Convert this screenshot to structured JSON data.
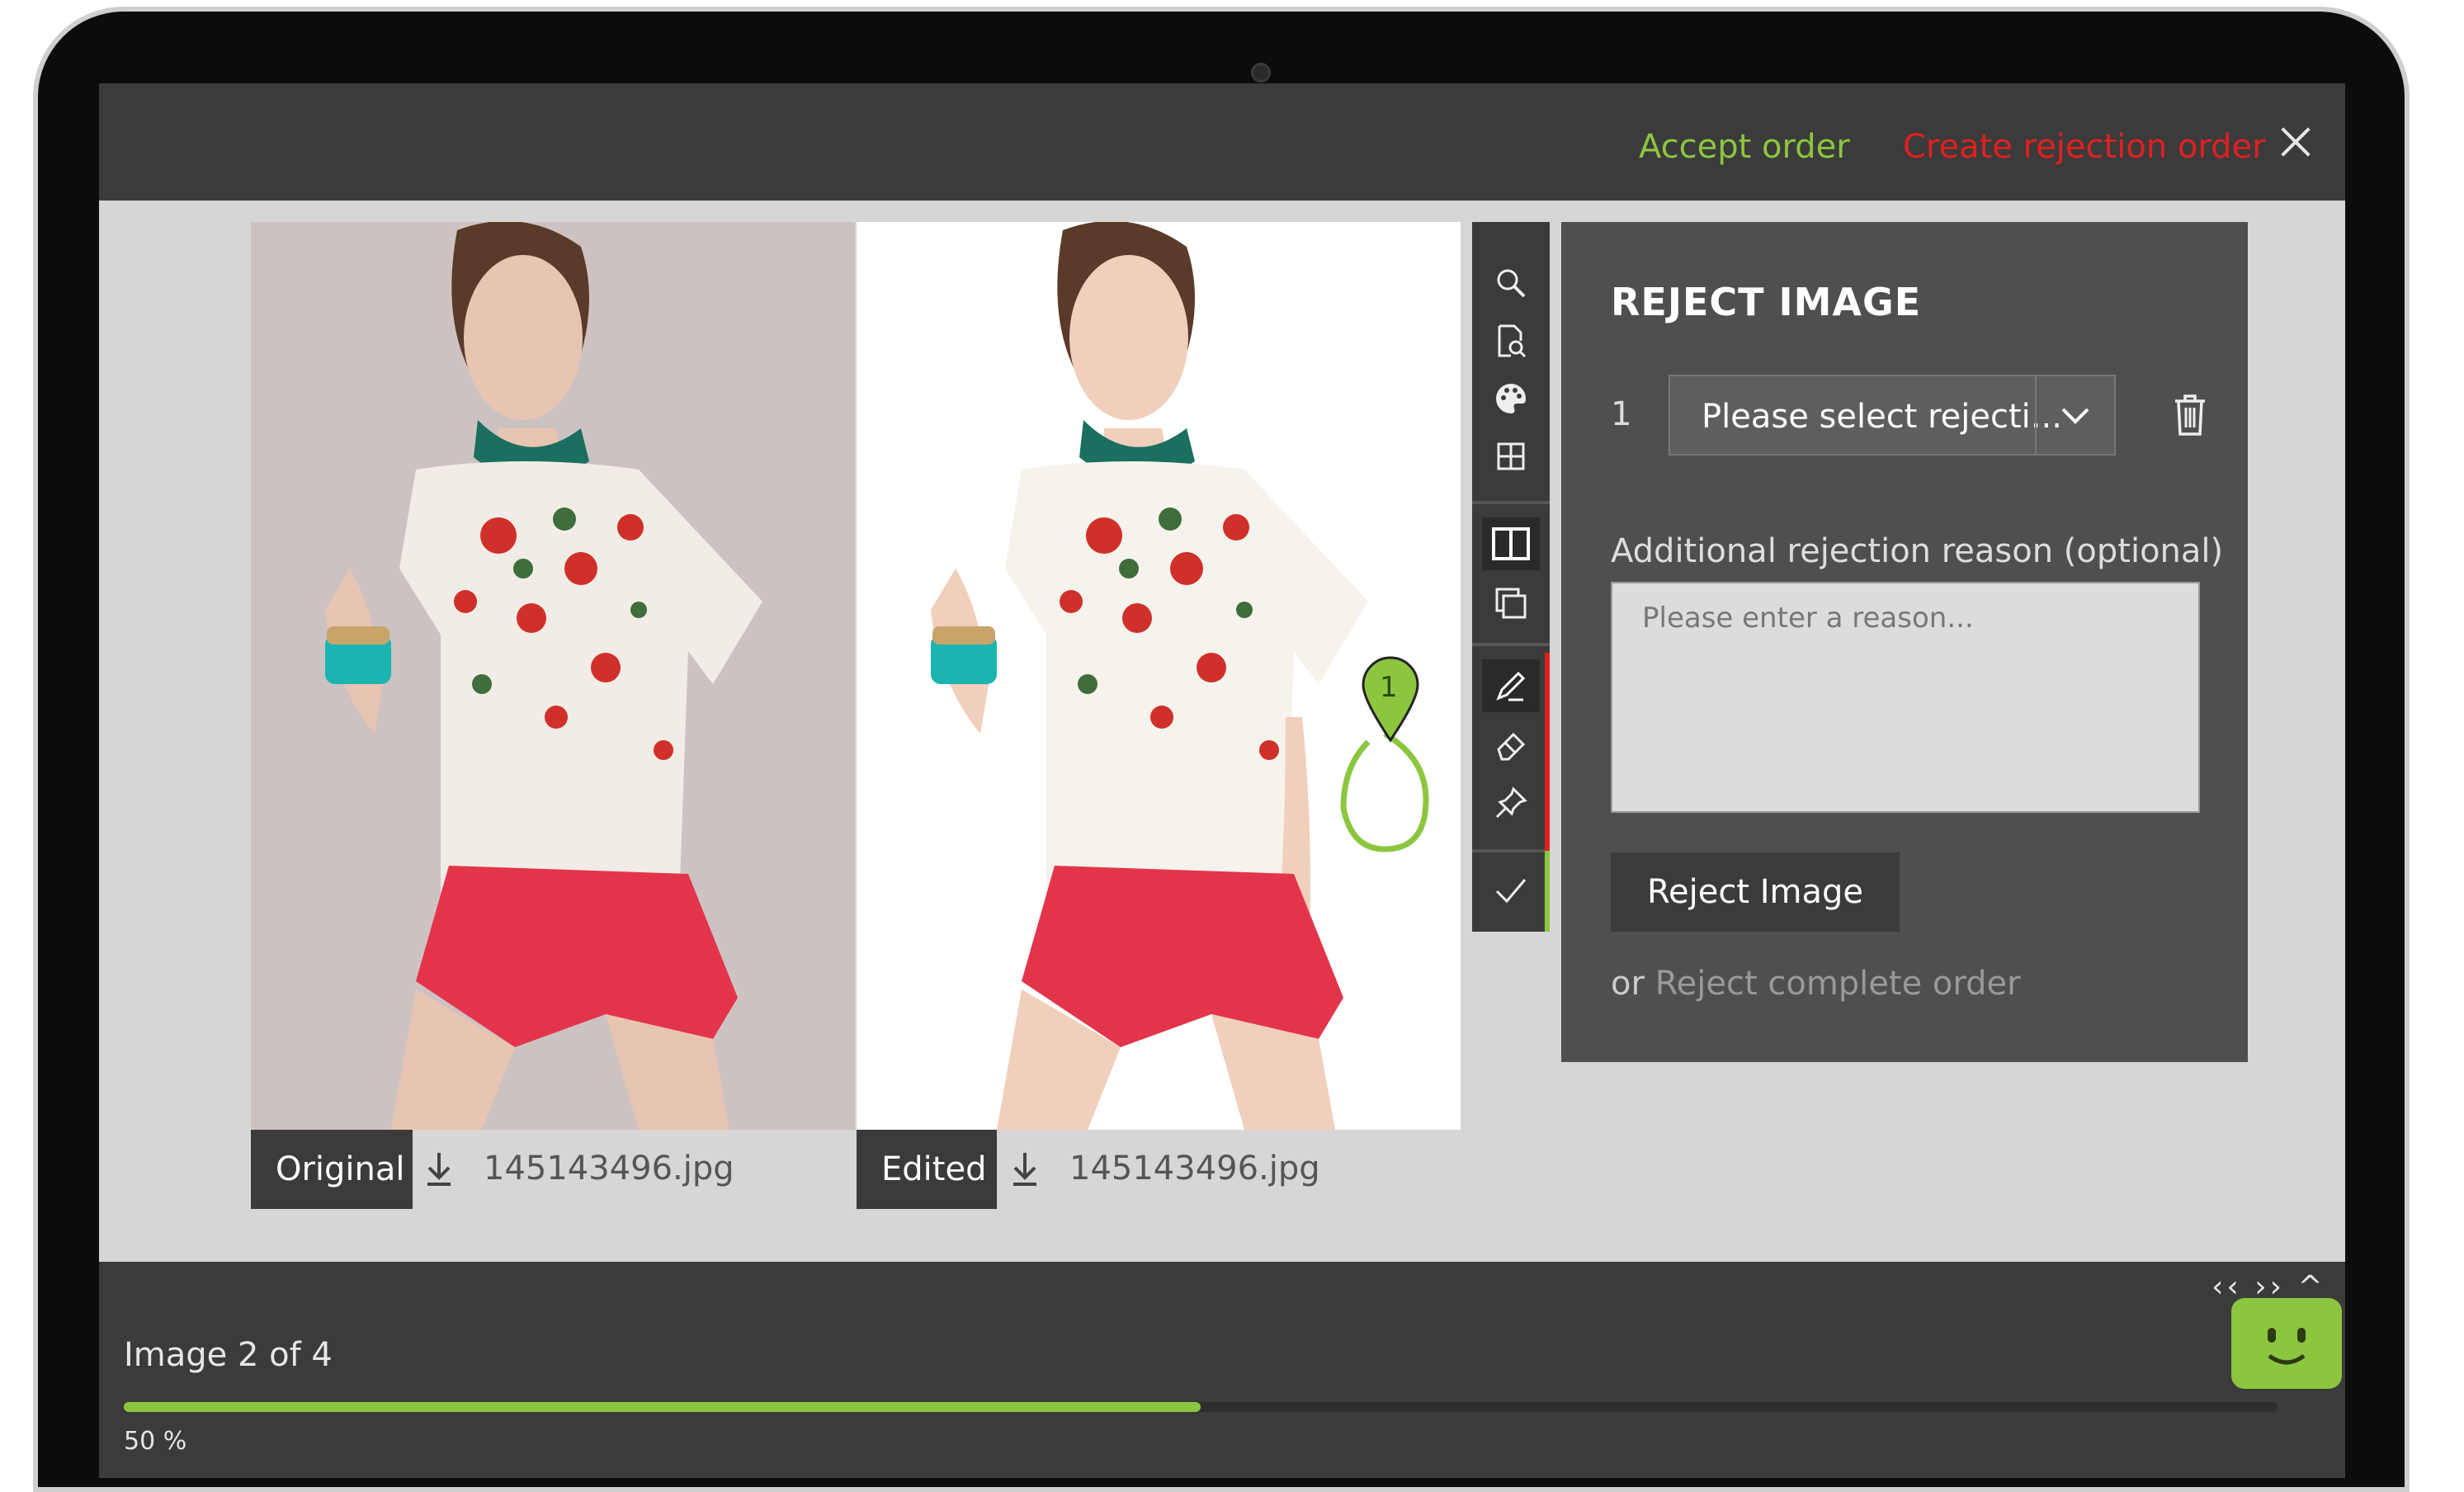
{
  "header": {
    "accept_label": "Accept order",
    "reject_order_label": "Create rejection order"
  },
  "images": {
    "original": {
      "label": "Original",
      "filename": "145143496.jpg"
    },
    "edited": {
      "label": "Edited",
      "filename": "145143496.jpg"
    },
    "marker_number": "1"
  },
  "toolbar": {
    "tools": [
      "search-icon",
      "file-search-icon",
      "palette-icon",
      "grid-icon",
      "split-view-icon",
      "overlay-icon",
      "pen-icon",
      "eraser-icon",
      "pin-icon",
      "check-icon"
    ],
    "active_tools": [
      "split-view-icon",
      "pen-icon"
    ]
  },
  "panel": {
    "title": "REJECT IMAGE",
    "row_number": "1",
    "select_placeholder": "Please select rejecti...",
    "additional_label": "Additional rejection reason (optional)",
    "textarea_placeholder": "Please enter a reason...",
    "reject_button": "Reject Image",
    "or_text": "or",
    "reject_complete_link": "Reject complete order"
  },
  "footer": {
    "image_count": "Image 2 of 4",
    "progress_percent": 50,
    "progress_text": "50 %",
    "nav_arrows": "‹‹ ›› ^"
  },
  "colors": {
    "accent_green": "#8cc63f",
    "danger_red": "#e02020",
    "dark": "#3b3b3b"
  }
}
